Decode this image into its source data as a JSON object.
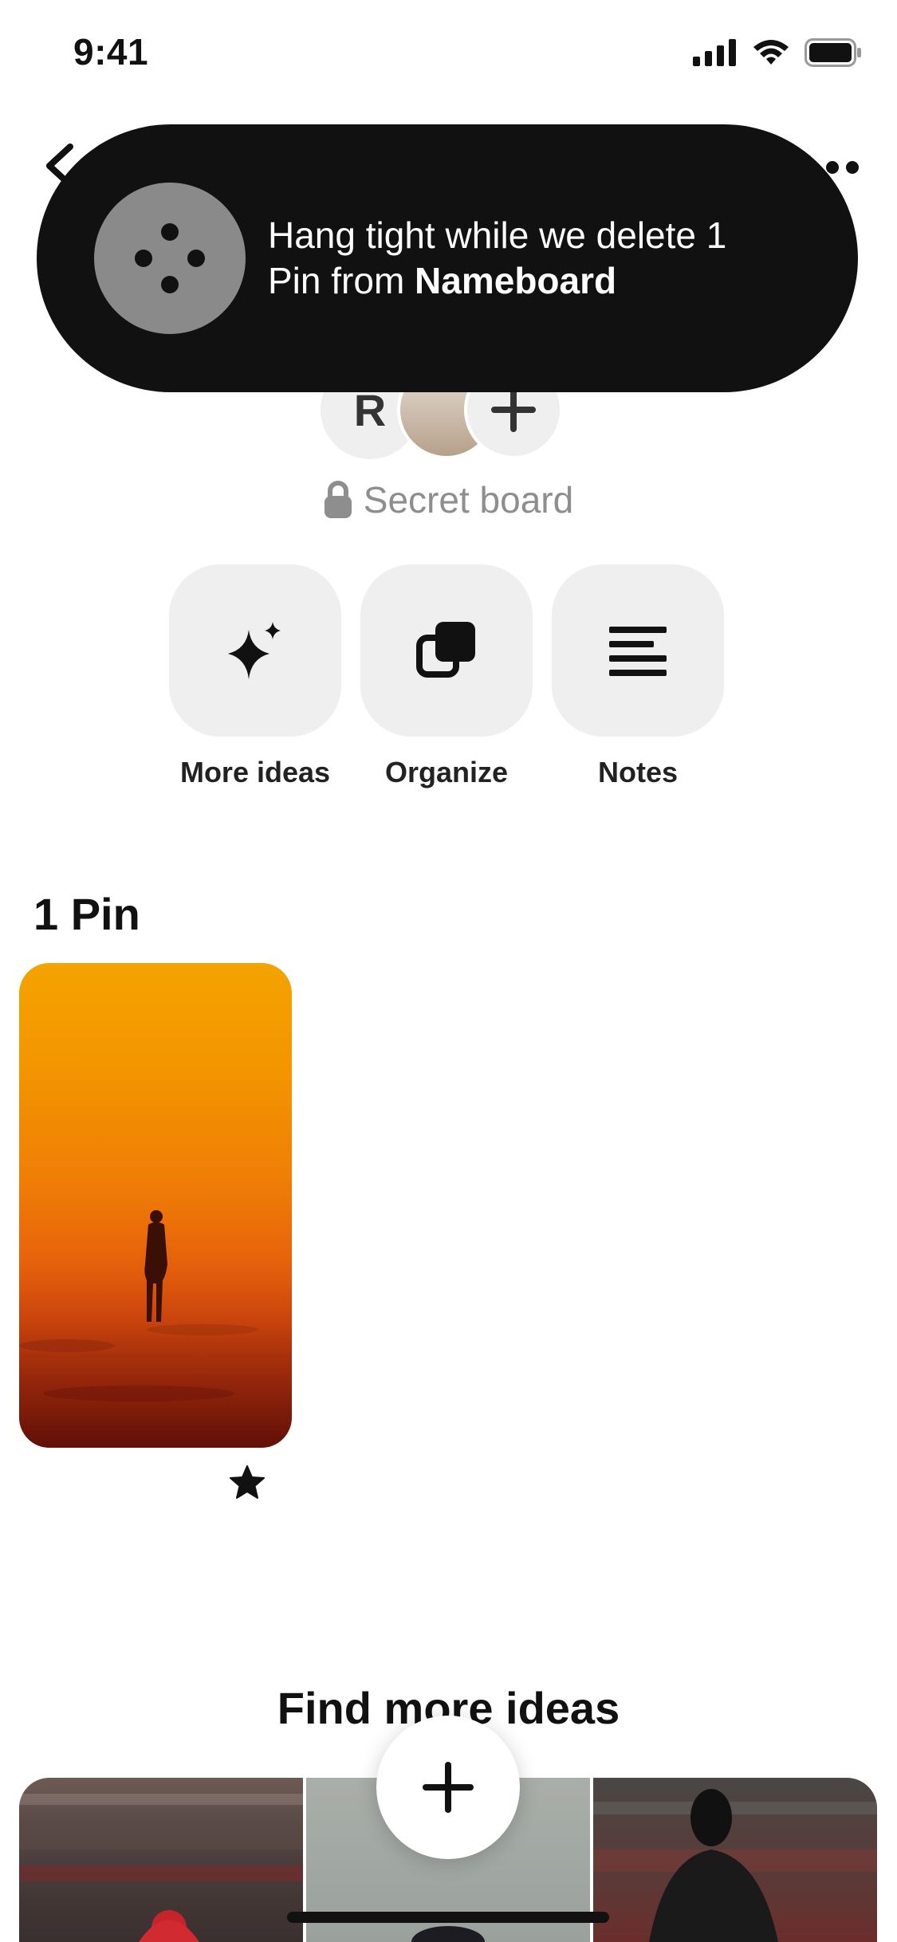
{
  "status_bar": {
    "time": "9:41",
    "icons": [
      "signal-icon",
      "wifi-icon",
      "battery-icon"
    ]
  },
  "header": {
    "back_icon": "chevron-left-icon",
    "more_icon": "ellipsis-icon"
  },
  "toast": {
    "icon": "loading-dots-icon",
    "message_prefix": "Hang tight while we delete 1 Pin from ",
    "board_name": "Nameboard"
  },
  "board": {
    "collaborator_initial": "R",
    "add_collaborator_icon": "plus-icon",
    "privacy_label": "Secret board",
    "privacy_icon": "lock-icon"
  },
  "actions": [
    {
      "label": "More ideas",
      "icon": "sparkle-icon"
    },
    {
      "label": "Organize",
      "icon": "organize-icon"
    },
    {
      "label": "Notes",
      "icon": "notes-lines-icon"
    }
  ],
  "pins": {
    "count_label": "1 Pin",
    "items": [
      {
        "image": "silhouette-in-orange-haze",
        "favorite_icon": "star-icon"
      }
    ]
  },
  "find_more": {
    "title": "Find more ideas"
  },
  "fab": {
    "icon": "plus-icon"
  },
  "colors": {
    "toast_bg": "#111111",
    "tile_bg": "#efefef",
    "secondary_text": "#8e8e8e"
  }
}
